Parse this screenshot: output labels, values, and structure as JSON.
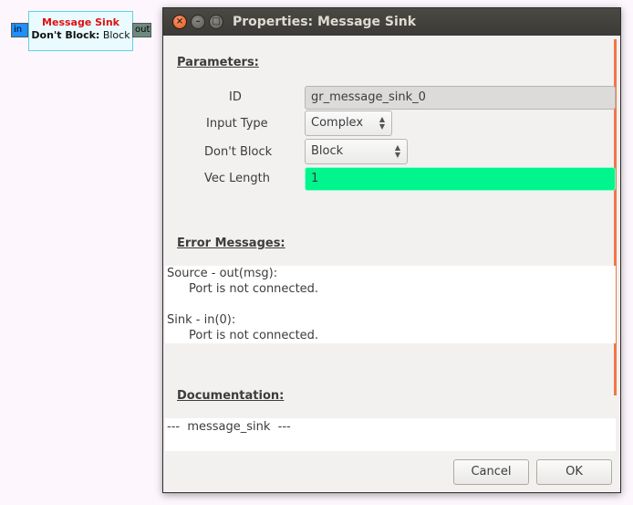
{
  "block": {
    "title": "Message Sink",
    "param_label": "Don't Block:",
    "param_value": "Block",
    "port_in": "in",
    "port_out": "out"
  },
  "dialog": {
    "title": "Properties: Message Sink",
    "window_buttons": [
      "close-icon",
      "minimize-icon",
      "maximize-icon"
    ],
    "parameters_heading": "Parameters:",
    "params": {
      "id_label": "ID",
      "id_value": "gr_message_sink_0",
      "input_type_label": "Input Type",
      "input_type_value": "Complex",
      "dont_block_label": "Don't Block",
      "dont_block_value": "Block",
      "vec_length_label": "Vec Length",
      "vec_length_value": "1"
    },
    "errors_heading": "Error Messages:",
    "errors": [
      {
        "source": "Source - out(msg):",
        "message": "Port is not connected."
      },
      {
        "source": "Sink - in(0):",
        "message": "Port is not connected."
      }
    ],
    "documentation_heading": "Documentation:",
    "documentation_text": "---  message_sink  ---",
    "cancel_label": "Cancel",
    "ok_label": "OK",
    "colors": {
      "vec_length_bg": "#00f58c",
      "block_title": "#e01010",
      "accent": "#f07746"
    }
  }
}
